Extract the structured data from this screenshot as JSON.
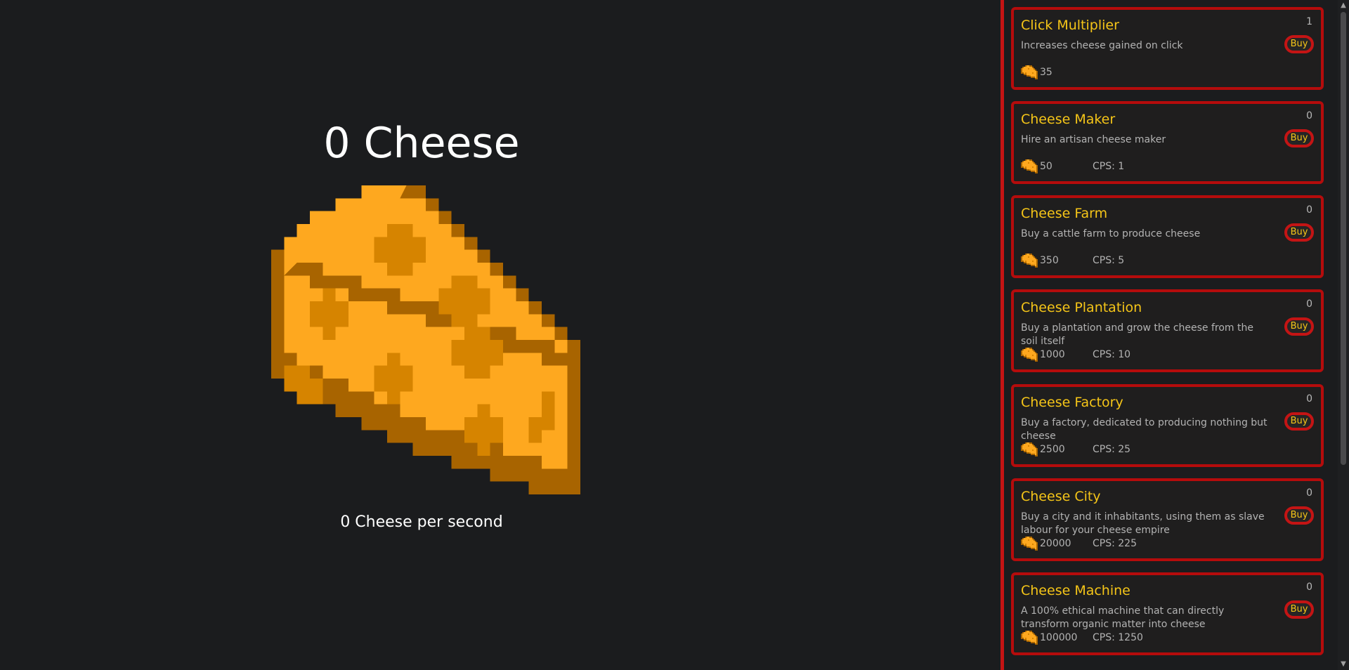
{
  "game": {
    "cheese_count_text": "0 Cheese",
    "cps_text": "0 Cheese per second"
  },
  "colors": {
    "background": "#1b1c1e",
    "accent_red": "#c41414",
    "item_title": "#f5c518",
    "cheese_main": "#fea81f",
    "cheese_dark": "#d68400",
    "cheese_edge": "#a86400"
  },
  "shop": {
    "buy_label": "Buy",
    "items": [
      {
        "name": "Click Multiplier",
        "owned": "1",
        "desc": "Increases cheese gained on click",
        "cost": "35",
        "cps": ""
      },
      {
        "name": "Cheese Maker",
        "owned": "0",
        "desc": "Hire an artisan cheese maker",
        "cost": "50",
        "cps": "CPS: 1"
      },
      {
        "name": "Cheese Farm",
        "owned": "0",
        "desc": "Buy a cattle farm to produce cheese",
        "cost": "350",
        "cps": "CPS: 5"
      },
      {
        "name": "Cheese Plantation",
        "owned": "0",
        "desc": "Buy a plantation and grow the cheese from the soil itself",
        "cost": "1000",
        "cps": "CPS: 10"
      },
      {
        "name": "Cheese Factory",
        "owned": "0",
        "desc": "Buy a factory, dedicated to producing nothing but cheese",
        "cost": "2500",
        "cps": "CPS: 25"
      },
      {
        "name": "Cheese City",
        "owned": "0",
        "desc": "Buy a city and it inhabitants, using them as slave labour for your cheese empire",
        "cost": "20000",
        "cps": "CPS: 225"
      },
      {
        "name": "Cheese Machine",
        "owned": "0",
        "desc": "A 100% ethical machine that can directly transform organic matter into cheese",
        "cost": "100000",
        "cps": "CPS: 1250"
      }
    ]
  }
}
